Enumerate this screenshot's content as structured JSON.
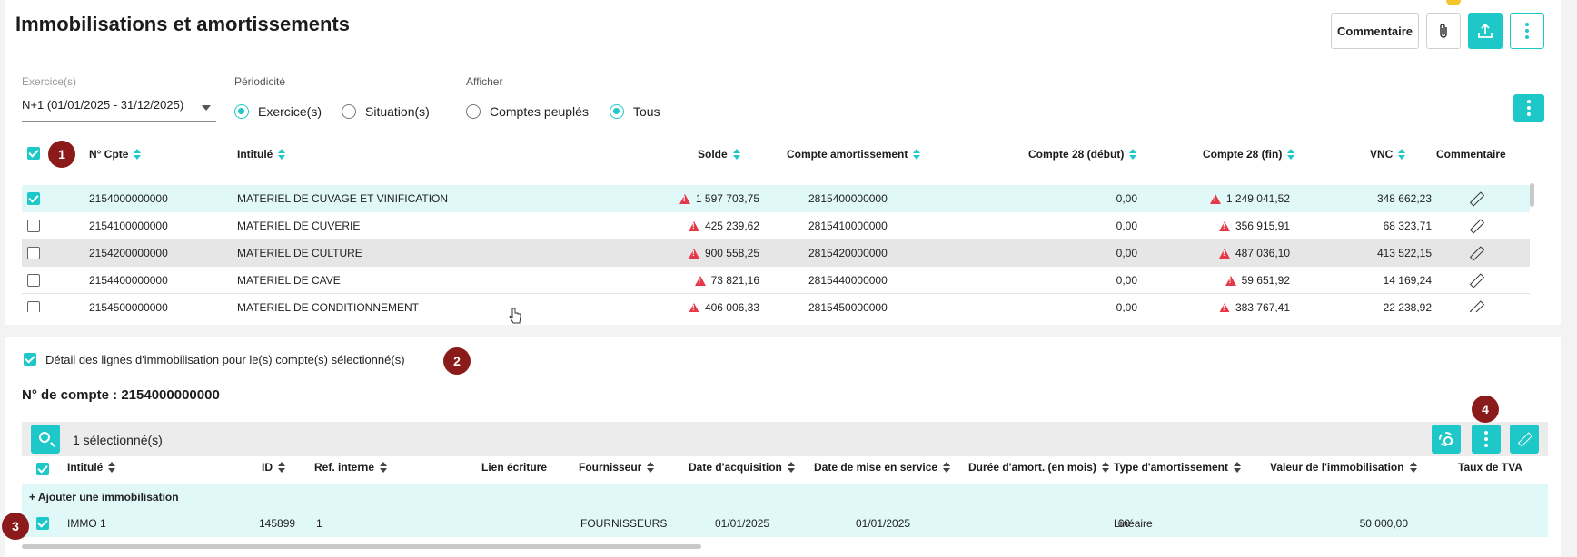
{
  "header": {
    "title": "Immobilisations et amortissements",
    "comment_button": "Commentaire",
    "icons": [
      "paperclip-icon",
      "upload-icon",
      "more-vertical-icon"
    ]
  },
  "filters": {
    "exercice_label": "Exercice(s)",
    "exercice_value": "N+1 (01/01/2025 - 31/12/2025)",
    "periodicite_label": "Périodicité",
    "periodicite_options": [
      "Exercice(s)",
      "Situation(s)"
    ],
    "periodicite_selected": "Exercice(s)",
    "afficher_label": "Afficher",
    "afficher_options": [
      "Comptes peuplés",
      "Tous"
    ],
    "afficher_selected": "Tous"
  },
  "main_table": {
    "headers": [
      "N° Cpte",
      "Intitulé",
      "Solde",
      "Compte amortissement",
      "Compte 28 (début)",
      "Compte 28 (fin)",
      "VNC",
      "Commentaire"
    ],
    "rows": [
      {
        "checked": true,
        "num": "2154000000000",
        "intitule": "MATERIEL DE CUVAGE ET VINIFICATION",
        "solde": "1 597 703,75",
        "compte_amort": "2815400000000",
        "debut": "0,00",
        "fin": "1 249 041,52",
        "vnc": "348 662,23"
      },
      {
        "checked": false,
        "num": "2154100000000",
        "intitule": "MATERIEL DE CUVERIE",
        "solde": "425 239,62",
        "compte_amort": "2815410000000",
        "debut": "0,00",
        "fin": "356 915,91",
        "vnc": "68 323,71"
      },
      {
        "checked": false,
        "num": "2154200000000",
        "intitule": "MATERIEL DE CULTURE",
        "solde": "900 558,25",
        "compte_amort": "2815420000000",
        "debut": "0,00",
        "fin": "487 036,10",
        "vnc": "413 522,15"
      },
      {
        "checked": false,
        "num": "2154400000000",
        "intitule": "MATERIEL DE CAVE",
        "solde": "73 821,16",
        "compte_amort": "2815440000000",
        "debut": "0,00",
        "fin": "59 651,92",
        "vnc": "14 169,24"
      },
      {
        "checked": false,
        "num": "2154500000000",
        "intitule": "MATERIEL DE CONDITIONNEMENT",
        "solde": "406 006,33",
        "compte_amort": "2815450000000",
        "debut": "0,00",
        "fin": "383 767,41",
        "vnc": "22 238,92"
      }
    ]
  },
  "badges": [
    "1",
    "2",
    "3",
    "4"
  ],
  "detail": {
    "checkbox_label": "Détail des lignes d'immobilisation pour le(s) compte(s) sélectionné(s)",
    "account_title": "N° de compte : 2154000000000",
    "selection_text": "1 sélectionné(s)",
    "headers": [
      "Intitulé",
      "ID",
      "Ref. interne",
      "Lien écriture",
      "Fournisseur",
      "Date d'acquisition",
      "Date de mise en service",
      "Durée d'amort. (en mois)",
      "Type d'amortissement",
      "Valeur de l'immobilisation",
      "Taux de TVA"
    ],
    "add_label": "+ Ajouter une immobilisation",
    "row": {
      "intitule": "IMMO 1",
      "id": "145899",
      "ref": "1",
      "lien": "",
      "fournisseur": "FOURNISSEURS",
      "date_acq": "01/01/2025",
      "date_service": "01/01/2025",
      "duree": "60",
      "type": "Linéaire",
      "valeur": "50 000,00",
      "tva": ""
    }
  },
  "colors": {
    "accent": "#1ec8c8",
    "badge": "#8b1a1a",
    "warning": "#e5394a",
    "selected_row": "#e0f8f8"
  }
}
